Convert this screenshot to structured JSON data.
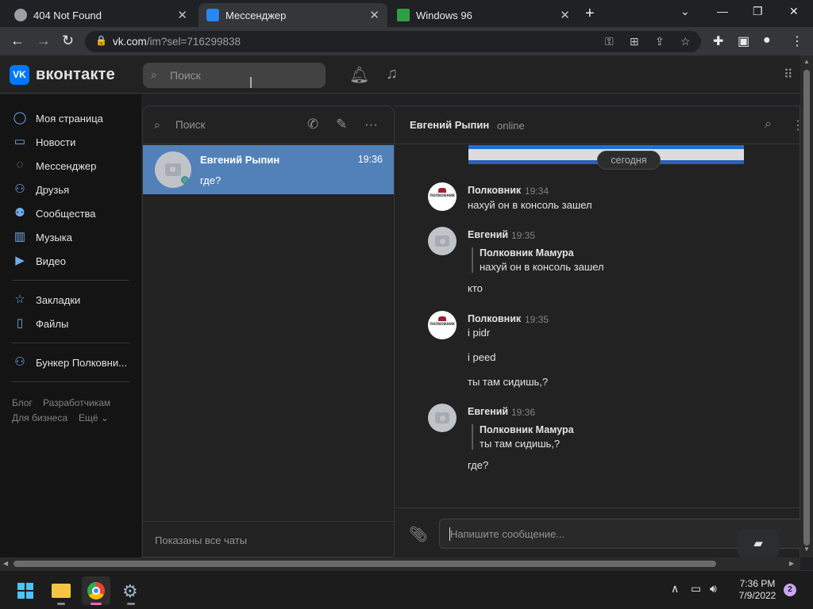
{
  "browser": {
    "tabs": [
      {
        "title": "404 Not Found",
        "icon": "globe-icon"
      },
      {
        "title": "Мессенджер",
        "icon": "vk-messenger-icon"
      },
      {
        "title": "Windows 96",
        "icon": "windows96-icon"
      }
    ],
    "new_tab": "+",
    "url_host": "vk.com",
    "url_path": "/im?sel=716299838"
  },
  "vk": {
    "brand": "вконтакте",
    "logo_text": "VK",
    "search_placeholder": "Поиск",
    "nav": [
      {
        "label": "Моя страница",
        "icon": "user-icon"
      },
      {
        "label": "Новости",
        "icon": "news-icon"
      },
      {
        "label": "Мессенджер",
        "icon": "message-icon"
      },
      {
        "label": "Друзья",
        "icon": "friends-icon"
      },
      {
        "label": "Сообщества",
        "icon": "communities-icon"
      },
      {
        "label": "Музыка",
        "icon": "music-icon"
      },
      {
        "label": "Видео",
        "icon": "video-icon"
      }
    ],
    "nav2": [
      {
        "label": "Закладки",
        "icon": "star-icon"
      },
      {
        "label": "Файлы",
        "icon": "files-icon"
      }
    ],
    "nav3": [
      {
        "label": "Бункер Полковни...",
        "icon": "group-icon"
      }
    ],
    "footer": {
      "blog": "Блог",
      "developers": "Разработчикам",
      "business": "Для бизнеса",
      "more": "Ещё ⌄"
    }
  },
  "chatlist": {
    "search_label": "Поиск",
    "chats": [
      {
        "name": "Евгений Рыпин",
        "time": "19:36",
        "preview": "где?",
        "online": true
      }
    ],
    "footer": "Показаны все чаты"
  },
  "conversation": {
    "name": "Евгений Рыпин",
    "status": "online",
    "date_divider": "сегодня",
    "messages": [
      {
        "author": "Полковник",
        "time": "19:34",
        "avatar": "logo",
        "avatar_text": "полковник",
        "texts": [
          "нахуй он в консоль зашел"
        ]
      },
      {
        "author": "Евгений",
        "time": "19:35",
        "avatar": "camera",
        "quote_author": "Полковник Мамура",
        "quote_text": "нахуй он в консоль зашел",
        "texts": [
          "кто"
        ]
      },
      {
        "author": "Полковник",
        "time": "19:35",
        "avatar": "logo",
        "avatar_text": "полковник",
        "texts": [
          "i pidr",
          "i peed",
          "ты там сидишь,?"
        ]
      },
      {
        "author": "Евгений",
        "time": "19:36",
        "avatar": "camera",
        "quote_author": "Полковник Мамура",
        "quote_text": "ты там сидишь,?",
        "texts": [
          "где?"
        ]
      }
    ],
    "composer_placeholder": "Напишите сообщение..."
  },
  "taskbar": {
    "time": "7:36 PM",
    "date": "7/9/2022",
    "notifications": "2"
  },
  "colors": {
    "accent": "#5181b8",
    "vk_blue": "#0077ff",
    "online": "#4bb34b"
  }
}
